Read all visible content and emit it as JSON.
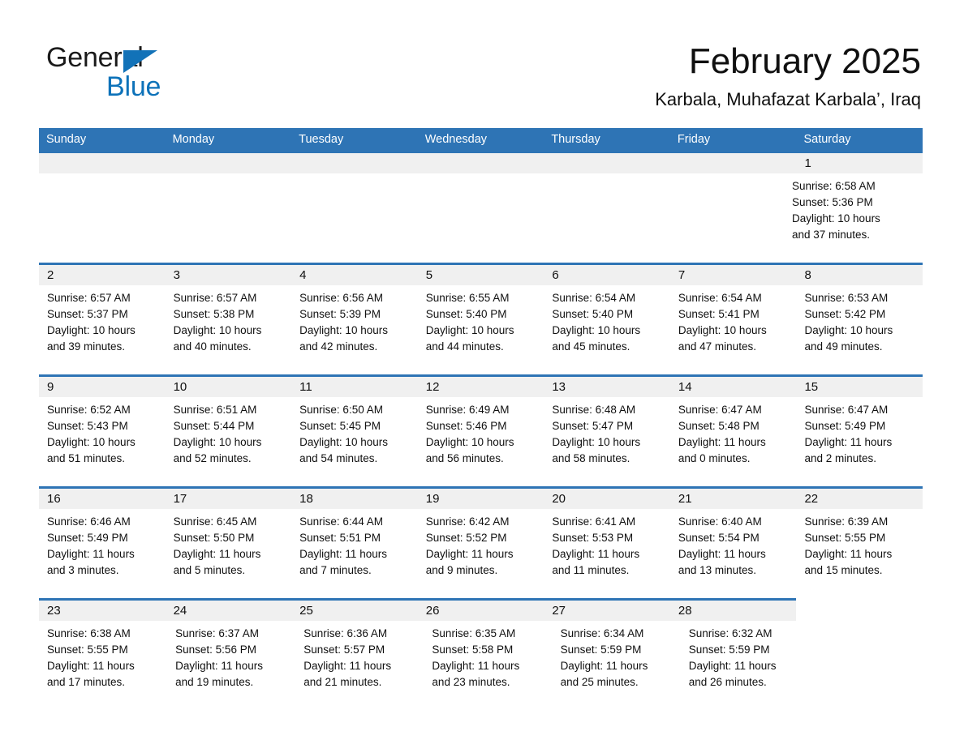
{
  "logo": {
    "word1": "General",
    "word2": "Blue",
    "triangle_color": "#1272b8",
    "blue_color": "#0d72b9"
  },
  "header": {
    "title": "February 2025",
    "subtitle": "Karbala, Muhafazat Karbala’, Iraq"
  },
  "colors": {
    "header_blue": "#2e74b5",
    "band_gray": "#f0f0f0",
    "text": "#101010"
  },
  "weekdays": [
    "Sunday",
    "Monday",
    "Tuesday",
    "Wednesday",
    "Thursday",
    "Friday",
    "Saturday"
  ],
  "weeks": [
    {
      "filled_columns": 7,
      "days": [
        {
          "num": "",
          "sunrise": "",
          "sunset": "",
          "daylight1": "",
          "daylight2": ""
        },
        {
          "num": "",
          "sunrise": "",
          "sunset": "",
          "daylight1": "",
          "daylight2": ""
        },
        {
          "num": "",
          "sunrise": "",
          "sunset": "",
          "daylight1": "",
          "daylight2": ""
        },
        {
          "num": "",
          "sunrise": "",
          "sunset": "",
          "daylight1": "",
          "daylight2": ""
        },
        {
          "num": "",
          "sunrise": "",
          "sunset": "",
          "daylight1": "",
          "daylight2": ""
        },
        {
          "num": "",
          "sunrise": "",
          "sunset": "",
          "daylight1": "",
          "daylight2": ""
        },
        {
          "num": "1",
          "sunrise": "Sunrise: 6:58 AM",
          "sunset": "Sunset: 5:36 PM",
          "daylight1": "Daylight: 10 hours",
          "daylight2": "and 37 minutes."
        }
      ]
    },
    {
      "filled_columns": 7,
      "days": [
        {
          "num": "2",
          "sunrise": "Sunrise: 6:57 AM",
          "sunset": "Sunset: 5:37 PM",
          "daylight1": "Daylight: 10 hours",
          "daylight2": "and 39 minutes."
        },
        {
          "num": "3",
          "sunrise": "Sunrise: 6:57 AM",
          "sunset": "Sunset: 5:38 PM",
          "daylight1": "Daylight: 10 hours",
          "daylight2": "and 40 minutes."
        },
        {
          "num": "4",
          "sunrise": "Sunrise: 6:56 AM",
          "sunset": "Sunset: 5:39 PM",
          "daylight1": "Daylight: 10 hours",
          "daylight2": "and 42 minutes."
        },
        {
          "num": "5",
          "sunrise": "Sunrise: 6:55 AM",
          "sunset": "Sunset: 5:40 PM",
          "daylight1": "Daylight: 10 hours",
          "daylight2": "and 44 minutes."
        },
        {
          "num": "6",
          "sunrise": "Sunrise: 6:54 AM",
          "sunset": "Sunset: 5:40 PM",
          "daylight1": "Daylight: 10 hours",
          "daylight2": "and 45 minutes."
        },
        {
          "num": "7",
          "sunrise": "Sunrise: 6:54 AM",
          "sunset": "Sunset: 5:41 PM",
          "daylight1": "Daylight: 10 hours",
          "daylight2": "and 47 minutes."
        },
        {
          "num": "8",
          "sunrise": "Sunrise: 6:53 AM",
          "sunset": "Sunset: 5:42 PM",
          "daylight1": "Daylight: 10 hours",
          "daylight2": "and 49 minutes."
        }
      ]
    },
    {
      "filled_columns": 7,
      "days": [
        {
          "num": "9",
          "sunrise": "Sunrise: 6:52 AM",
          "sunset": "Sunset: 5:43 PM",
          "daylight1": "Daylight: 10 hours",
          "daylight2": "and 51 minutes."
        },
        {
          "num": "10",
          "sunrise": "Sunrise: 6:51 AM",
          "sunset": "Sunset: 5:44 PM",
          "daylight1": "Daylight: 10 hours",
          "daylight2": "and 52 minutes."
        },
        {
          "num": "11",
          "sunrise": "Sunrise: 6:50 AM",
          "sunset": "Sunset: 5:45 PM",
          "daylight1": "Daylight: 10 hours",
          "daylight2": "and 54 minutes."
        },
        {
          "num": "12",
          "sunrise": "Sunrise: 6:49 AM",
          "sunset": "Sunset: 5:46 PM",
          "daylight1": "Daylight: 10 hours",
          "daylight2": "and 56 minutes."
        },
        {
          "num": "13",
          "sunrise": "Sunrise: 6:48 AM",
          "sunset": "Sunset: 5:47 PM",
          "daylight1": "Daylight: 10 hours",
          "daylight2": "and 58 minutes."
        },
        {
          "num": "14",
          "sunrise": "Sunrise: 6:47 AM",
          "sunset": "Sunset: 5:48 PM",
          "daylight1": "Daylight: 11 hours",
          "daylight2": "and 0 minutes."
        },
        {
          "num": "15",
          "sunrise": "Sunrise: 6:47 AM",
          "sunset": "Sunset: 5:49 PM",
          "daylight1": "Daylight: 11 hours",
          "daylight2": "and 2 minutes."
        }
      ]
    },
    {
      "filled_columns": 7,
      "days": [
        {
          "num": "16",
          "sunrise": "Sunrise: 6:46 AM",
          "sunset": "Sunset: 5:49 PM",
          "daylight1": "Daylight: 11 hours",
          "daylight2": "and 3 minutes."
        },
        {
          "num": "17",
          "sunrise": "Sunrise: 6:45 AM",
          "sunset": "Sunset: 5:50 PM",
          "daylight1": "Daylight: 11 hours",
          "daylight2": "and 5 minutes."
        },
        {
          "num": "18",
          "sunrise": "Sunrise: 6:44 AM",
          "sunset": "Sunset: 5:51 PM",
          "daylight1": "Daylight: 11 hours",
          "daylight2": "and 7 minutes."
        },
        {
          "num": "19",
          "sunrise": "Sunrise: 6:42 AM",
          "sunset": "Sunset: 5:52 PM",
          "daylight1": "Daylight: 11 hours",
          "daylight2": "and 9 minutes."
        },
        {
          "num": "20",
          "sunrise": "Sunrise: 6:41 AM",
          "sunset": "Sunset: 5:53 PM",
          "daylight1": "Daylight: 11 hours",
          "daylight2": "and 11 minutes."
        },
        {
          "num": "21",
          "sunrise": "Sunrise: 6:40 AM",
          "sunset": "Sunset: 5:54 PM",
          "daylight1": "Daylight: 11 hours",
          "daylight2": "and 13 minutes."
        },
        {
          "num": "22",
          "sunrise": "Sunrise: 6:39 AM",
          "sunset": "Sunset: 5:55 PM",
          "daylight1": "Daylight: 11 hours",
          "daylight2": "and 15 minutes."
        }
      ]
    },
    {
      "filled_columns": 6,
      "days": [
        {
          "num": "23",
          "sunrise": "Sunrise: 6:38 AM",
          "sunset": "Sunset: 5:55 PM",
          "daylight1": "Daylight: 11 hours",
          "daylight2": "and 17 minutes."
        },
        {
          "num": "24",
          "sunrise": "Sunrise: 6:37 AM",
          "sunset": "Sunset: 5:56 PM",
          "daylight1": "Daylight: 11 hours",
          "daylight2": "and 19 minutes."
        },
        {
          "num": "25",
          "sunrise": "Sunrise: 6:36 AM",
          "sunset": "Sunset: 5:57 PM",
          "daylight1": "Daylight: 11 hours",
          "daylight2": "and 21 minutes."
        },
        {
          "num": "26",
          "sunrise": "Sunrise: 6:35 AM",
          "sunset": "Sunset: 5:58 PM",
          "daylight1": "Daylight: 11 hours",
          "daylight2": "and 23 minutes."
        },
        {
          "num": "27",
          "sunrise": "Sunrise: 6:34 AM",
          "sunset": "Sunset: 5:59 PM",
          "daylight1": "Daylight: 11 hours",
          "daylight2": "and 25 minutes."
        },
        {
          "num": "28",
          "sunrise": "Sunrise: 6:32 AM",
          "sunset": "Sunset: 5:59 PM",
          "daylight1": "Daylight: 11 hours",
          "daylight2": "and 26 minutes."
        },
        {
          "num": "",
          "sunrise": "",
          "sunset": "",
          "daylight1": "",
          "daylight2": ""
        }
      ]
    }
  ]
}
